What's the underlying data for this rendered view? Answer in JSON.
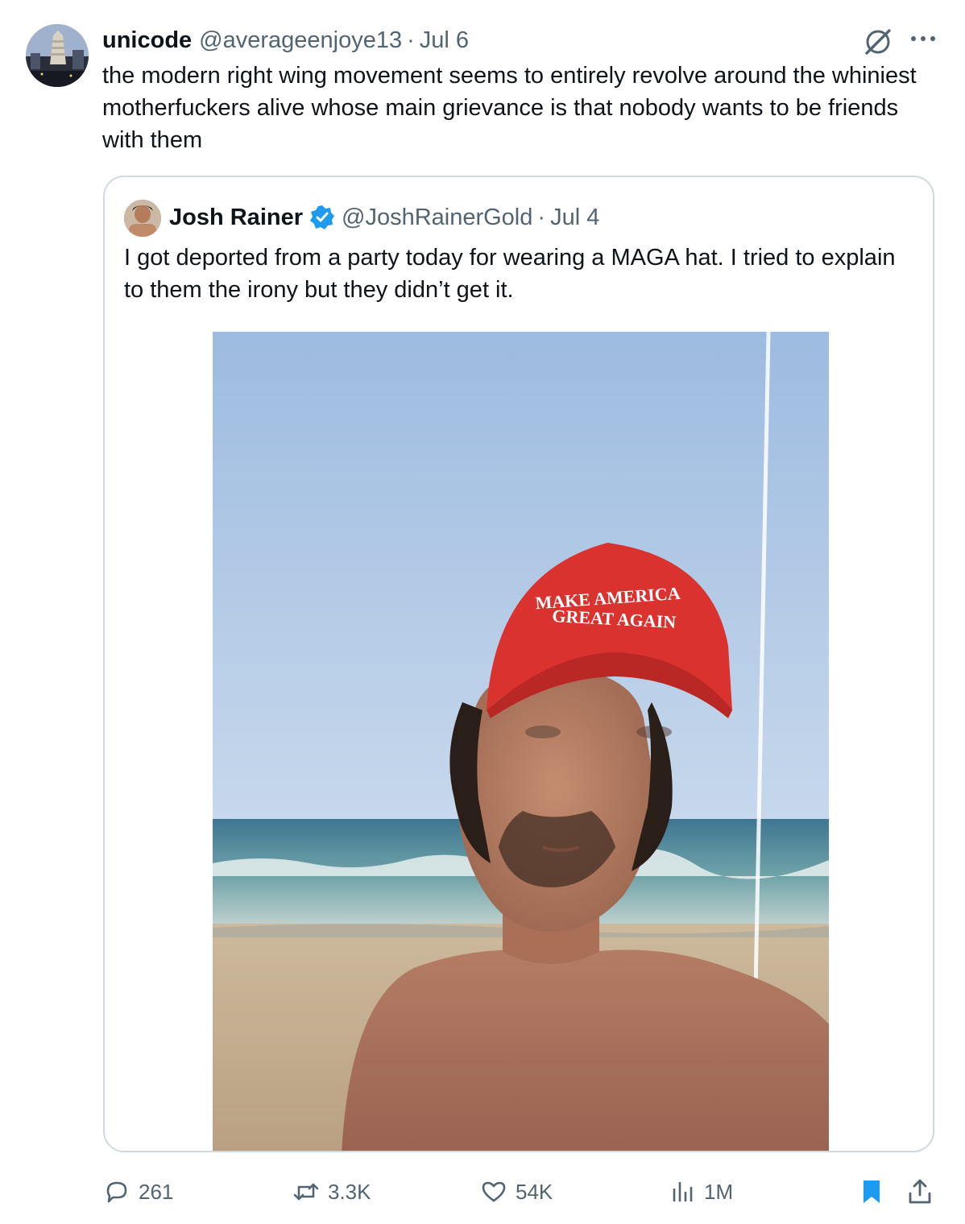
{
  "tweet": {
    "author": {
      "name": "unicode",
      "handle": "@averageenjoye13",
      "separator": "·",
      "date": "Jul 6",
      "avatar_icon": "avatar-cityscape"
    },
    "text": "the modern right wing movement seems to entirely revolve around the whiniest motherfuckers alive whose main grievance is that nobody wants to be friends with them",
    "header_icons": [
      "grok-icon",
      "more-icon"
    ]
  },
  "quote": {
    "author": {
      "name": "Josh Rainer",
      "handle": "@JoshRainerGold",
      "separator": "·",
      "date": "Jul 4",
      "verified": true,
      "verified_color": "#1d9bf0"
    },
    "text": "I got deported from a party today for wearing a MAGA hat. I tried to explain to them the irony but they didn’t get it.",
    "image": {
      "hat_text_line1": "MAKE AMERICA",
      "hat_text_line2": "GREAT AGAIN"
    }
  },
  "actions": {
    "reply_count": "261",
    "retweet_count": "3.3K",
    "like_count": "54K",
    "views_count": "1M",
    "bookmark_active": true,
    "bookmark_color": "#1d9bf0",
    "icons": [
      "reply-icon",
      "retweet-icon",
      "like-icon",
      "views-icon",
      "bookmark-icon",
      "share-icon"
    ]
  }
}
